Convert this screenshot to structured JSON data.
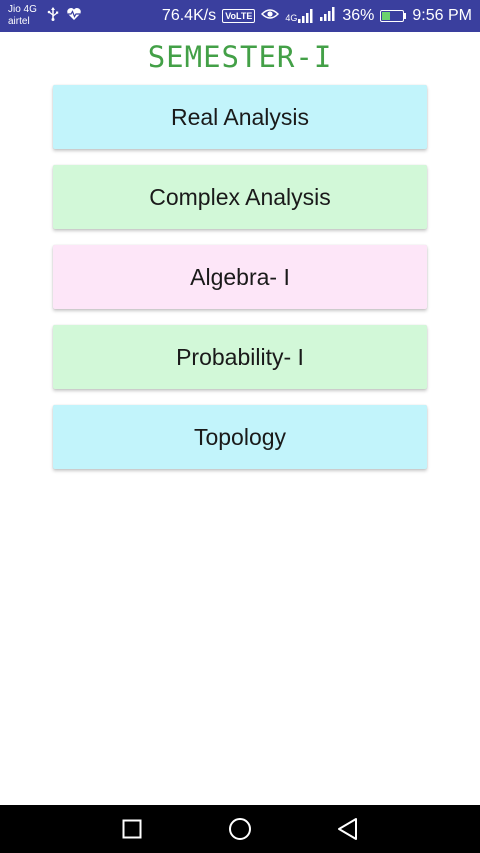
{
  "status_bar": {
    "carrier_line1": "Jio 4G",
    "carrier_line2": "airtel",
    "net_speed": "76.4K/s",
    "volte": "VoLTE",
    "signal_4g_label": "4G",
    "battery_percent": "36%",
    "battery_level": 0.36,
    "time": "9:56 PM",
    "icons": [
      "usb-icon",
      "heart-health-icon",
      "eye-icon",
      "signal-4g-icon",
      "signal-icon",
      "battery-charging-icon"
    ]
  },
  "page": {
    "title": "SEMESTER-I"
  },
  "subjects": [
    {
      "label": "Real Analysis",
      "color": "#c2f4fb"
    },
    {
      "label": "Complex Analysis",
      "color": "#d2f8d8"
    },
    {
      "label": "Algebra- I",
      "color": "#fde6f8"
    },
    {
      "label": "Probability- I",
      "color": "#d2f8d8"
    },
    {
      "label": "Topology",
      "color": "#c2f4fb"
    }
  ],
  "nav_bar": {
    "buttons": [
      "recents-square-icon",
      "home-circle-icon",
      "back-triangle-icon"
    ]
  },
  "colors": {
    "status_bar_bg": "#3a3f9e",
    "title_color": "#43a047",
    "nav_bar_bg": "#000000"
  }
}
